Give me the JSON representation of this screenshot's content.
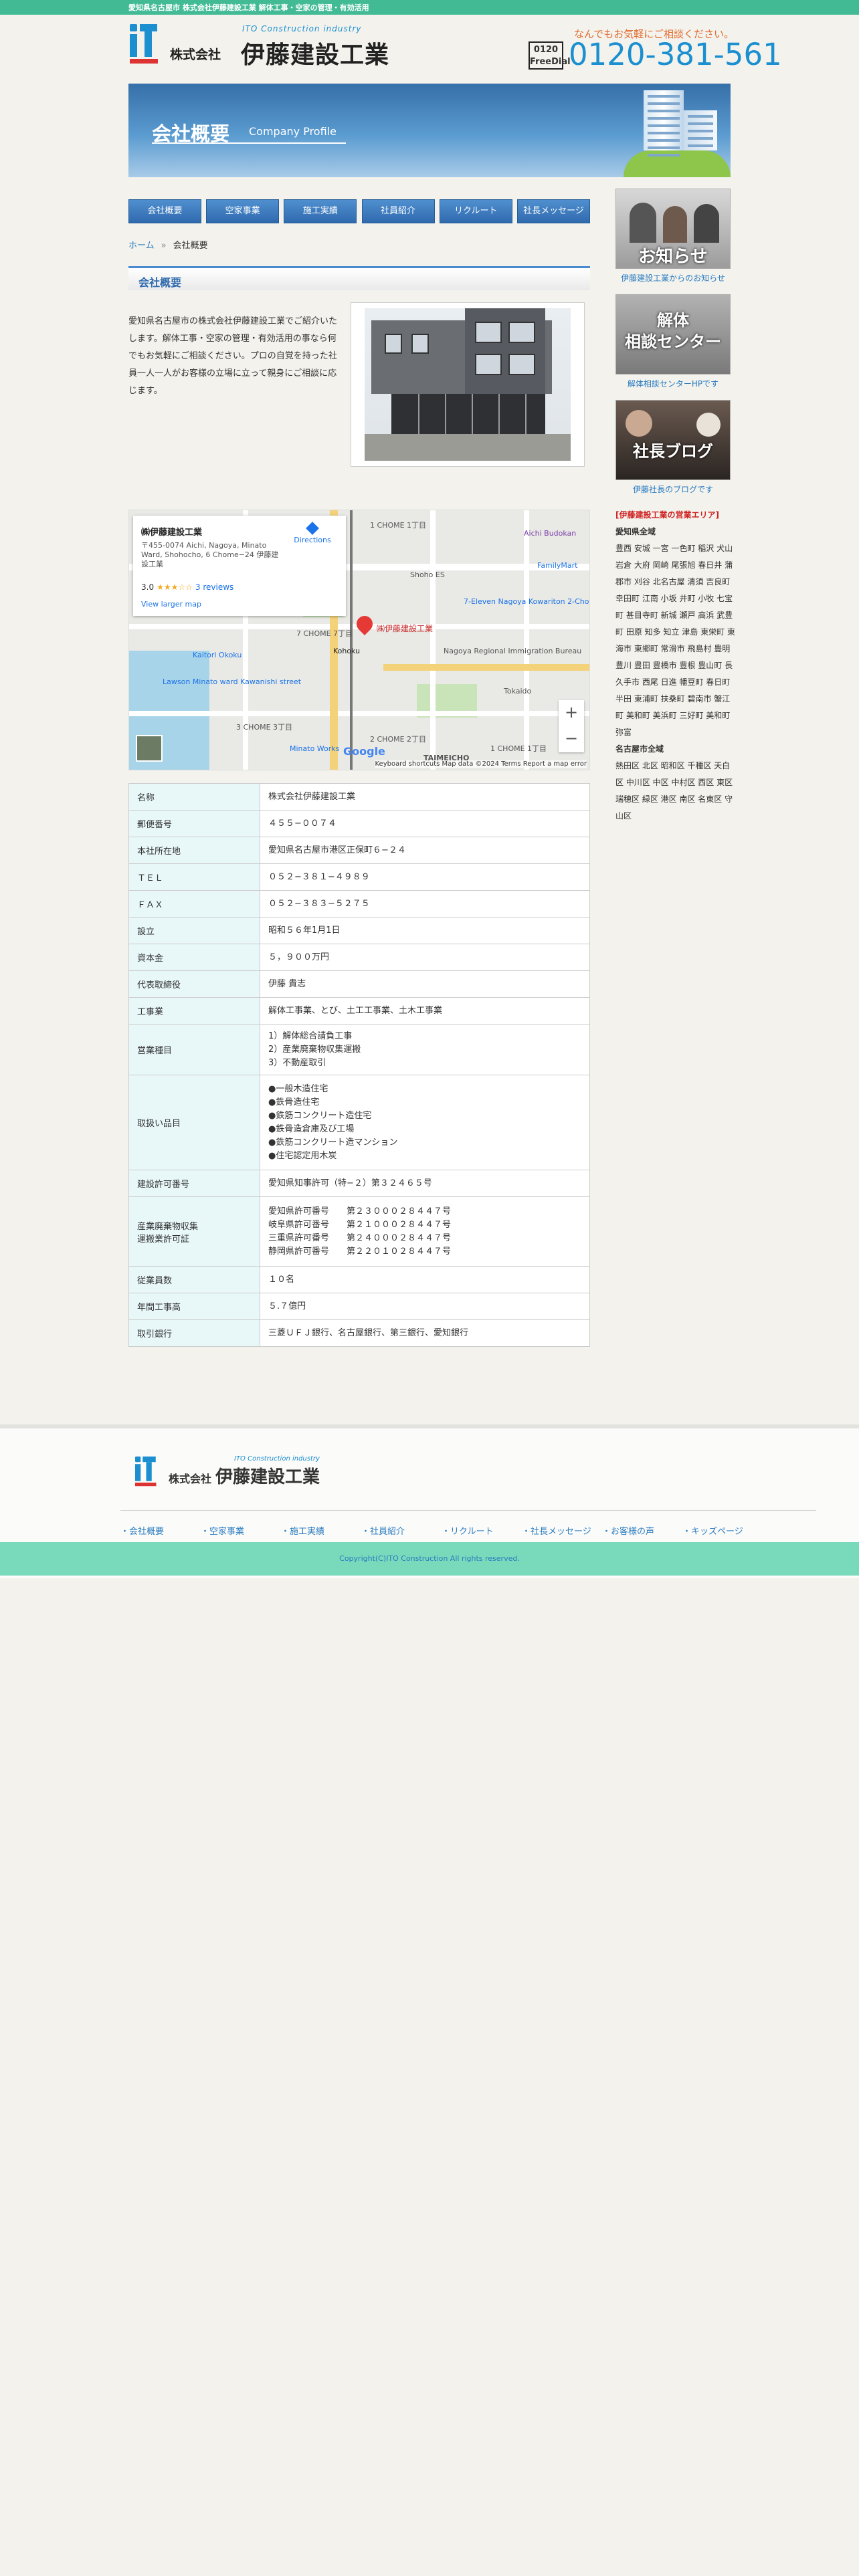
{
  "topbar": {
    "text": "愛知県名古屋市 株式会社伊藤建設工業 解体工事・空家の管理・有効活用"
  },
  "logo": {
    "mark": "ito",
    "en": "ITO Construction industry",
    "kabushiki": "株式会社",
    "name": "伊藤建設工業"
  },
  "tel": {
    "lead": "なんでもお気軽にご相談ください。",
    "freedial": "0120 FreeDial",
    "number": "0120-381-561"
  },
  "hero": {
    "title": "会社概要",
    "en": "Company Profile"
  },
  "nav": [
    "会社概要",
    "空家事業",
    "施工実績",
    "社員紹介",
    "リクルート",
    "社長メッセージ"
  ],
  "breadcrumb": {
    "home": "ホーム",
    "sep": "»",
    "current": "会社概要"
  },
  "heading": "会社概要",
  "intro": "愛知県名古屋市の株式会社伊藤建設工業でご紹介いたします。解体工事・空家の管理・有効活用の事なら何でもお気軽にご相談ください。プロの自覚を持った社員一人一人がお客様の立場に立って親身にご相談に応じます。",
  "map": {
    "place": "㈱伊藤建設工業",
    "address": "〒455-0074 Aichi, Nagoya, Minato Ward, Shohocho, 6 Chome−24 伊藤建設工業",
    "rating": "3.0",
    "stars": "★★★☆☆",
    "reviews": "3 reviews",
    "larger": "View larger map",
    "directions": "Directions",
    "pin_label": "㈱伊藤建設工業",
    "labels": [
      "1 CHOME 1丁目",
      "Aichi Budokan",
      "Shoho ES",
      "FamilyMart",
      "7-Eleven Nagoya Kowariton 2-Chome",
      "Kaitori Okoku",
      "Kohoku",
      "Nagoya Regional Immigration Bureau",
      "Lawson Minato ward Kawanishi street",
      "Minato Works",
      "TAIMEICHO",
      "Tokaido",
      "2 CHOME 2丁目",
      "3 CHOME 3丁目",
      "7 CHOME 7丁目",
      "1 CHOME 1丁目"
    ],
    "zoom_in": "+",
    "zoom_out": "−",
    "google": "Google",
    "attribution": "Keyboard shortcuts  Map data ©2024  Terms  Report a map error"
  },
  "info": [
    {
      "label": "名称",
      "value": "株式会社伊藤建設工業"
    },
    {
      "label": "郵便番号",
      "value": "４５５−００７４"
    },
    {
      "label": "本社所在地",
      "value": "愛知県名古屋市港区正保町６−２４"
    },
    {
      "label": "ＴＥＬ",
      "value": "０５２−３８１−４９８９"
    },
    {
      "label": "ＦＡＸ",
      "value": "０５２−３８３−５２７５"
    },
    {
      "label": "設立",
      "value": "昭和５６年1月1日"
    },
    {
      "label": "資本金",
      "value": "５，９００万円"
    },
    {
      "label": "代表取締役",
      "value": "伊藤 貴志"
    },
    {
      "label": "工事業",
      "value": "解体工事業、とび、土工工事業、土木工事業"
    },
    {
      "label": "営業種目",
      "value": "1）解体総合請負工事\n2）産業廃棄物収集運搬\n3）不動産取引"
    },
    {
      "label": "取扱い品目",
      "value": "●一般木造住宅\n●鉄骨造住宅\n●鉄筋コンクリート造住宅\n●鉄骨造倉庫及び工場\n●鉄筋コンクリート造マンション\n●住宅認定用木炭"
    },
    {
      "label": "建設許可番号",
      "value": "愛知県知事許可（特−２）第３２４６５号"
    },
    {
      "label": "産業廃棄物収集\n運搬業許可証",
      "value": "愛知県許可番号　　第２３０００２８４４７号\n岐阜県許可番号　　第２１０００２８４４７号\n三重県許可番号　　第２４０００２８４４７号\n静岡県許可番号　　第２２０１０２８４４７号"
    },
    {
      "label": "従業員数",
      "value": "１０名"
    },
    {
      "label": "年間工事高",
      "value": "５.７億円"
    },
    {
      "label": "取引銀行",
      "value": "三菱ＵＦＪ銀行、名古屋銀行、第三銀行、愛知銀行"
    }
  ],
  "sidebar": {
    "banners": [
      {
        "caption": "お知らせ",
        "link": "伊藤建設工業からのお知らせ"
      },
      {
        "caption": "解体\n相談センター",
        "link": "解体相談センターHPです"
      },
      {
        "caption": "社長ブログ",
        "link": "伊藤社長のブログです"
      }
    ],
    "area_title": "[伊藤建設工業の営業エリア]",
    "area_aichi": "愛知県全域",
    "area_aichi_list": "豊西 安城 一宮 一色町 稲沢 犬山 岩倉 大府 岡崎 尾張旭 春日井 蒲郡市 刈谷 北名古屋 清須 吉良町 幸田町 江南 小坂 井町 小牧 七宝町 甚目寺町 新城 瀬戸 高浜 武豊町 田原 知多 知立 津島 東栄町 東海市 東郷町 常滑市 飛島村 豊明 豊川 豊田 豊橋市 豊根 豊山町 長久手市 西尾 日進 幡豆町 春日町 半田 東浦町 扶桑町 碧南市 蟹江町 美和町 美浜町 三好町 美和町 弥富",
    "area_nagoya": "名古屋市全域",
    "area_nagoya_list": "熱田区 北区 昭和区 千種区 天白区 中川区 中区 中村区 西区 東区 瑞穂区 緑区 港区 南区 名東区 守山区"
  },
  "footer": {
    "kabushiki": "株式会社",
    "name": "伊藤建設工業",
    "en": "ITO Construction industry",
    "nav": [
      "会社概要",
      "空家事業",
      "施工実績",
      "社員紹介",
      "リクルート",
      "社長メッセージ",
      "お客様の声",
      "キッズページ"
    ],
    "copyright": "Copyright(C)ITO Construction All rights reserved."
  }
}
